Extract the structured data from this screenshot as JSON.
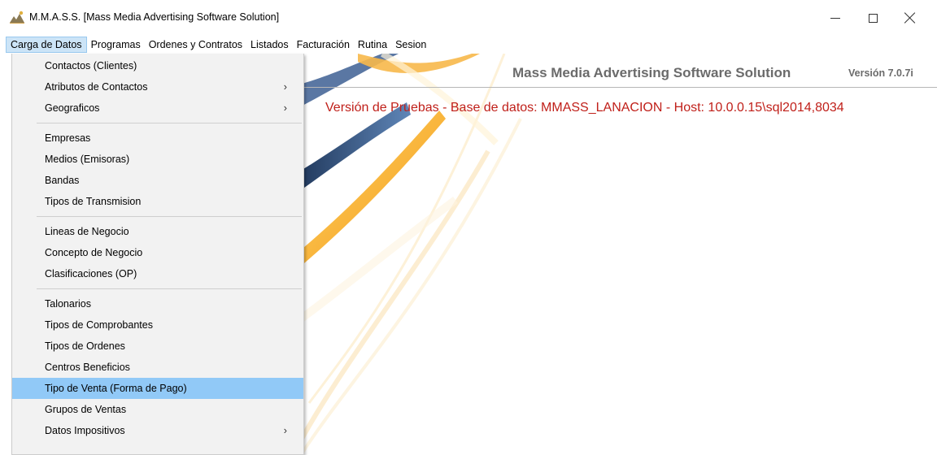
{
  "window": {
    "title": "M.M.A.S.S. [Mass Media Advertising Software Solution]"
  },
  "menubar": {
    "items": [
      {
        "label": "Carga de Datos",
        "active": true
      },
      {
        "label": "Programas"
      },
      {
        "label": "Ordenes y Contratos"
      },
      {
        "label": "Listados"
      },
      {
        "label": "Facturación"
      },
      {
        "label": "Rutina"
      },
      {
        "label": "Sesion"
      }
    ]
  },
  "header": {
    "brand": "Mass Media Advertising Software Solution",
    "version": "Versión 7.0.7i"
  },
  "banner": {
    "text": "Versión de Pruebas - Base de datos: MMASS_LANACION - Host: 10.0.0.15\\sql2014,8034"
  },
  "dropdown": {
    "items": [
      {
        "label": "Contactos (Clientes)"
      },
      {
        "label": "Atributos de Contactos",
        "submenu": true
      },
      {
        "label": "Geograficos",
        "submenu": true
      },
      {
        "label": "Empresas"
      },
      {
        "label": "Medios (Emisoras)"
      },
      {
        "label": "Bandas"
      },
      {
        "label": "Tipos de Transmision"
      },
      {
        "label": "Lineas de Negocio"
      },
      {
        "label": "Concepto de Negocio"
      },
      {
        "label": "Clasificaciones (OP)"
      },
      {
        "label": "Talonarios"
      },
      {
        "label": "Tipos de Comprobantes"
      },
      {
        "label": "Tipos de Ordenes"
      },
      {
        "label": "Centros Beneficios"
      },
      {
        "label": "Tipo de Venta (Forma de Pago)",
        "highlighted": true
      },
      {
        "label": "Grupos de Ventas"
      },
      {
        "label": "Datos Impositivos",
        "submenu": true
      }
    ],
    "submenu_glyph": "›"
  },
  "colors": {
    "menu_active_bg": "#cce4f7",
    "item_highlight_bg": "#91c9f7",
    "banner_red": "#c0201a",
    "brand_gray": "#6b6b6b",
    "art_orange": "#f39a12",
    "art_blue": "#2c4a78"
  }
}
